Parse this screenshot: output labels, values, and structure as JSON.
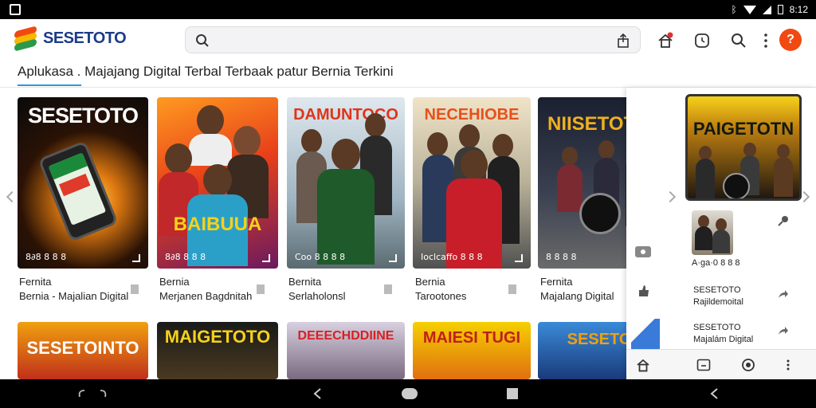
{
  "status_bar": {
    "time": "8:12"
  },
  "app": {
    "logo_text": "SESETOTO",
    "tagline": "Aplukasa . Majajang Digital Terbal Terbaak patur Bernia Terkini",
    "avatar_letter": "?",
    "search_placeholder": ""
  },
  "cards": [
    {
      "poster": "SESETOTO",
      "caption": "8∂8 8 8 8",
      "name": "Fernita",
      "sub": "Bernia - Majalian Digital"
    },
    {
      "poster": "BAIBUUA",
      "caption": "8∂8 8 8 8",
      "name": "Bernia",
      "sub": "Merjanen Bagdnitah"
    },
    {
      "poster": "DAMUNTOCO",
      "caption": "Coo 8 8 8 8",
      "name": "Bernita",
      "sub": "Serlaholonsl"
    },
    {
      "poster": "NECEHIOBE",
      "caption": "Ioclcaffo 8 8 8",
      "name": "Bernia",
      "sub": "Tarootones"
    },
    {
      "poster": "NIISETOT",
      "caption": "8 8 8 8",
      "name": "Fernita",
      "sub": "Majalang Digital"
    }
  ],
  "cards_row2": [
    {
      "poster": "SESETOINTO"
    },
    {
      "poster": "MAIGETOTO"
    },
    {
      "poster": "DEEECHDDIINE"
    },
    {
      "poster": "MAIESI TUGI"
    },
    {
      "poster": "SESETO"
    }
  ],
  "panel": {
    "poster": "PAIGETOTN",
    "small_caption": "A·ga·0 8 8 8",
    "items": [
      {
        "title": "SESETOTO",
        "sub": "Rajildemoital"
      },
      {
        "title": "SESETOTO",
        "sub": "Majalám Digital"
      }
    ]
  },
  "colors": {
    "accent": "#2a9ad8",
    "brand": "#1b3b8a",
    "avatar": "#f04a12"
  }
}
